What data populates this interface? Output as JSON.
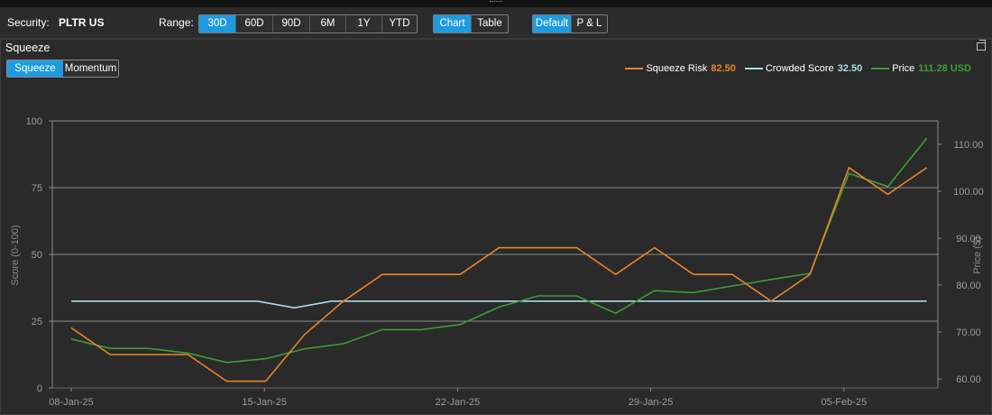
{
  "toolbar": {
    "security_label": "Security:",
    "security_value": "PLTR US",
    "range_label": "Range:",
    "range_options": [
      "30D",
      "60D",
      "90D",
      "6M",
      "1Y",
      "YTD"
    ],
    "range_selected": "30D",
    "view_options": [
      "Chart",
      "Table"
    ],
    "view_selected": "Chart",
    "mode_options": [
      "Default",
      "P & L"
    ],
    "mode_selected": "Default"
  },
  "panel": {
    "title": "Squeeze",
    "tabs": [
      "Squeeze",
      "Momentum"
    ],
    "tab_selected": "Squeeze"
  },
  "colors": {
    "squeeze_risk": "#e8842a",
    "crowded_score": "#a9dbe8",
    "price": "#3a9e36",
    "accent": "#1e9be0"
  },
  "legend": [
    {
      "name": "Squeeze Risk",
      "value": "82.50",
      "color": "#e8842a"
    },
    {
      "name": "Crowded Score",
      "value": "32.50",
      "color": "#a9dbe8"
    },
    {
      "name": "Price",
      "value": "111.28 USD",
      "color": "#3a9e36"
    }
  ],
  "chart_data": {
    "type": "line",
    "x": [
      "2025-01-08",
      "2025-01-09",
      "2025-01-10",
      "2025-01-11",
      "2025-01-12",
      "2025-01-13",
      "2025-01-14",
      "2025-01-15",
      "2025-01-16",
      "2025-01-17",
      "2025-01-18",
      "2025-01-19",
      "2025-01-20",
      "2025-01-21",
      "2025-01-22",
      "2025-01-23",
      "2025-01-24",
      "2025-01-25",
      "2025-01-26",
      "2025-01-27",
      "2025-01-28",
      "2025-01-29",
      "2025-01-30",
      "2025-01-31",
      "2025-02-01",
      "2025-02-02",
      "2025-02-03",
      "2025-02-04",
      "2025-02-05",
      "2025-02-06",
      "2025-02-07",
      "2025-02-08",
      "2025-02-09"
    ],
    "x_ticks": [
      "08-Jan-25",
      "15-Jan-25",
      "22-Jan-25",
      "29-Jan-25",
      "05-Feb-25"
    ],
    "series": [
      {
        "name": "Squeeze Risk",
        "axis": "left",
        "values": [
          22.5,
          null,
          12.5,
          null,
          12.5,
          null,
          12.5,
          null,
          2.5,
          null,
          2.5,
          null,
          20,
          null,
          32.5,
          null,
          42.5,
          null,
          42.5,
          null,
          42.5,
          null,
          52.5,
          null,
          52.5,
          null,
          52.5,
          null,
          42.5,
          null,
          52.5,
          null,
          42.5,
          null,
          42.5,
          null,
          32.5,
          null,
          42.5,
          null,
          82.5,
          null,
          72.5,
          null,
          82.5
        ]
      },
      {
        "name": "Crowded Score",
        "axis": "left",
        "values": [
          32.5,
          32.5,
          32.5,
          32.5,
          32.5,
          32.5,
          30,
          32.5,
          32.5,
          32.5,
          32.5,
          32.5,
          32.5,
          32.5,
          32.5,
          32.5,
          32.5,
          32.5,
          32.5,
          32.5,
          32.5,
          32.5,
          32.5,
          32.5
        ]
      },
      {
        "name": "Price",
        "axis": "right",
        "values": [
          68.5,
          66.5,
          66.5,
          65.5,
          63.5,
          64.3,
          66.4,
          67.5,
          70.5,
          70.5,
          71.6,
          75.3,
          77.7,
          77.7,
          74.0,
          78.8,
          78.4,
          79.8,
          81.2,
          82.5,
          103.8,
          101.0,
          111.28
        ]
      }
    ],
    "ylabel_left": "Score (0-100)",
    "ylabel_right": "Price ($)",
    "yticks_left": [
      0,
      25,
      50,
      75,
      100
    ],
    "yticks_right": [
      "60.00",
      "70.00",
      "80.00",
      "90.00",
      "100.00",
      "110.00"
    ],
    "ylim_left": [
      0,
      100
    ],
    "ylim_right": [
      58,
      115
    ],
    "grid": true,
    "legend_position": "top-right"
  }
}
